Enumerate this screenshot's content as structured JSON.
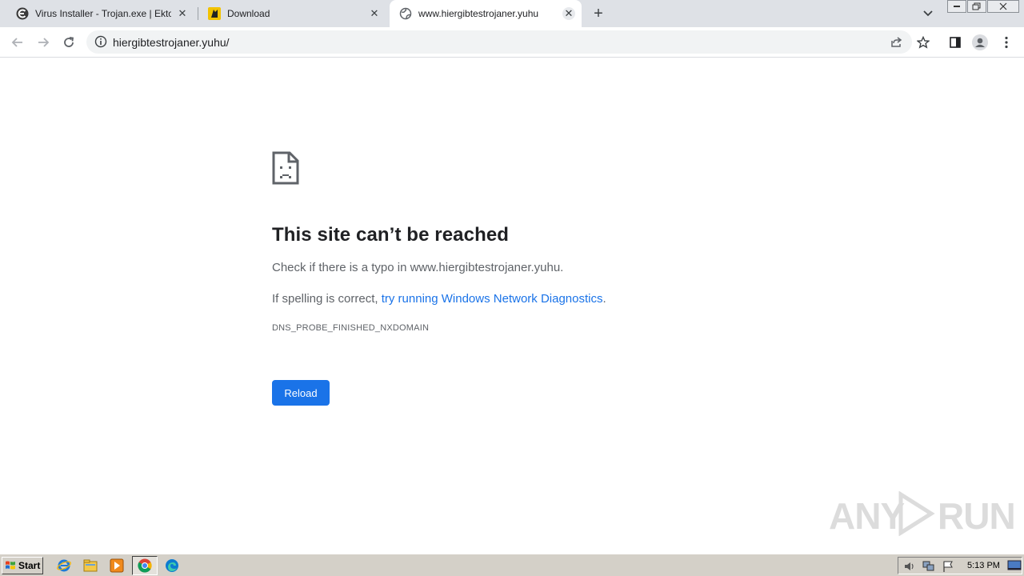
{
  "tabs": [
    {
      "title": "Virus Installer - Trojan.exe | Ektoplazm",
      "favicon": "ektoplazm-favicon",
      "active": false
    },
    {
      "title": "Download",
      "favicon": "download-site-favicon",
      "active": false
    },
    {
      "title": "www.hiergibtestrojaner.yuhu",
      "favicon": "globe-icon",
      "active": true
    }
  ],
  "tab_close_glyph": "✕",
  "new_tab_glyph": "+",
  "omnibox": {
    "url": "hiergibtestrojaner.yuhu/"
  },
  "error_page": {
    "heading": "This site can’t be reached",
    "line1": "Check if there is a typo in www.hiergibtestrojaner.yuhu.",
    "line2_prefix": "If spelling is correct, ",
    "line2_link": "try running Windows Network Diagnostics",
    "line2_suffix": ".",
    "error_code": "DNS_PROBE_FINISHED_NXDOMAIN",
    "reload_label": "Reload"
  },
  "watermark": {
    "left": "ANY",
    "right": "RUN"
  },
  "taskbar": {
    "start_label": "Start",
    "clock": "5:13 PM"
  },
  "colors": {
    "link": "#1a73e8",
    "button": "#1a73e8",
    "tabstrip": "#dee1e6"
  }
}
